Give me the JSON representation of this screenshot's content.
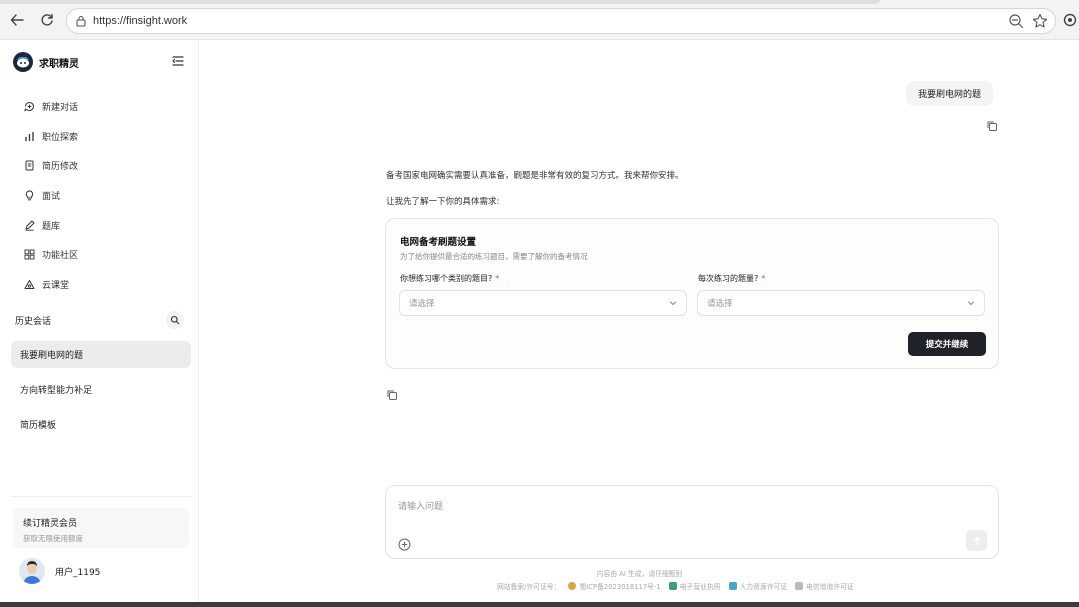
{
  "browser": {
    "url": "https://finsight.work"
  },
  "sidebar": {
    "brand_name": "求职精灵",
    "menu": [
      {
        "label": "新建对话",
        "icon": "chat-plus-icon"
      },
      {
        "label": "职位探索",
        "icon": "bar-chart-icon"
      },
      {
        "label": "简历修改",
        "icon": "document-icon"
      },
      {
        "label": "面试",
        "icon": "lightbulb-icon"
      },
      {
        "label": "题库",
        "icon": "pencil-icon"
      },
      {
        "label": "功能社区",
        "icon": "grid-icon"
      },
      {
        "label": "云课堂",
        "icon": "triangle-shapes-icon"
      }
    ],
    "history_title": "历史会话",
    "history": [
      {
        "label": "我要刷电网的题",
        "active": true
      },
      {
        "label": "方向转型能力补足",
        "active": false
      },
      {
        "label": "简历模板",
        "active": false
      }
    ],
    "member": {
      "title": "续订精灵会员",
      "subtitle": "获取无限使用额度"
    },
    "user_name": "用户_1195"
  },
  "chat": {
    "user_message": "我要刷电网的题",
    "ai_line1": "备考国家电网确实需要认真准备，刷题是非常有效的复习方式。我来帮你安排。",
    "ai_line2": "让我先了解一下你的具体需求:",
    "form": {
      "title": "电网备考刷题设置",
      "description": "为了给你提供最合适的练习题目，需要了解你的备考情况",
      "field1_label": "你想练习哪个类别的题目?",
      "field1_placeholder": "请选择",
      "field2_label": "每次练习的题量?",
      "field2_placeholder": "请选择",
      "required_mark": "*",
      "submit_label": "提交并继续"
    },
    "input_placeholder": "请输入问题"
  },
  "footer": {
    "note": "内容由 AI 生成，请仔细甄别",
    "filing": "网站备案/许可证号：",
    "icp": "蜀ICP备2023018117号-1",
    "license1": "电子营业执照",
    "license2": "人力资源许可证",
    "license3": "电信增值许可证"
  },
  "colors": {
    "primary_button": "#1f2329",
    "required": "#e5484d",
    "active_history": "#ececec"
  }
}
